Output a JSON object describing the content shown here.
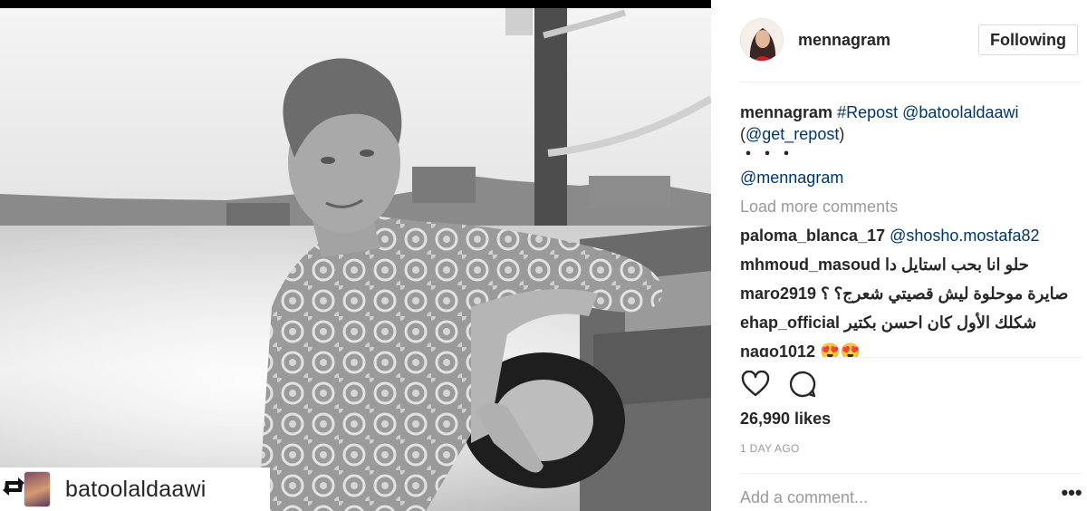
{
  "post": {
    "author": "mennagram",
    "follow_label": "Following",
    "repost_credit_user": "batoolaldaawi"
  },
  "caption": {
    "user": "mennagram",
    "hashtag": "#Repost",
    "mention": "@batoolaldaawi",
    "repost_open": "(",
    "repost_handle": "@get_repost",
    "repost_close": ")",
    "ellipsis": "・・・",
    "mention_line": "@mennagram"
  },
  "load_more_label": "Load more comments",
  "comments": [
    {
      "user": "paloma_blanca_17",
      "text": "@shosho.mostafa82"
    },
    {
      "user": "mhmoud_masoud",
      "text": "حلو انا بحب استايل دا"
    },
    {
      "user": "maro2919",
      "text": "صايرة موحلوة ليش قصيتي شعرج؟ ؟"
    },
    {
      "user": "ehap_official",
      "text": "شكلك الأول كان احسن بكتير"
    },
    {
      "user": "nago1012",
      "text": "😍😍"
    }
  ],
  "likes_text": "26,990 likes",
  "timestamp": "1 DAY AGO",
  "add_comment_placeholder": "Add a comment...",
  "more_options_label": "•••",
  "icons": {
    "like": "heart-icon",
    "comment": "speech-bubble-icon",
    "repost": "repost-icon"
  },
  "colors": {
    "link": "#003569",
    "muted": "#999999",
    "text": "#262626",
    "border": "#dbdbdb"
  }
}
